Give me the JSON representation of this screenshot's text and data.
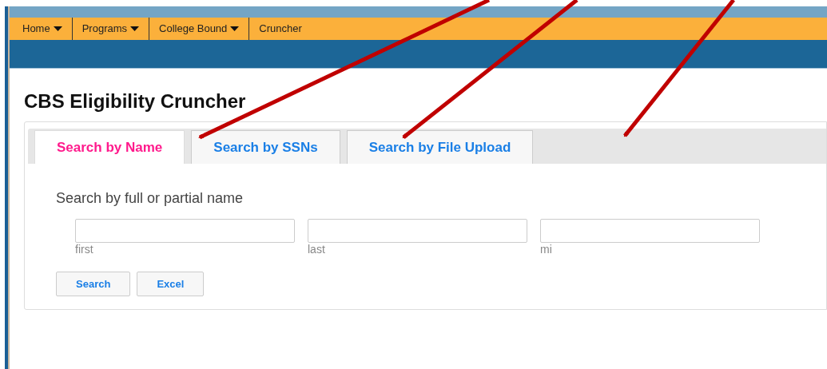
{
  "nav": {
    "items": [
      {
        "label": "Home",
        "dropdown": true
      },
      {
        "label": "Programs",
        "dropdown": true
      },
      {
        "label": "College Bound",
        "dropdown": true
      },
      {
        "label": "Cruncher",
        "dropdown": false
      }
    ]
  },
  "page_title": "CBS Eligibility Cruncher",
  "tabs": [
    {
      "label": "Search by Name",
      "selected": true
    },
    {
      "label": "Search by SSNs",
      "selected": false
    },
    {
      "label": "Search by File Upload",
      "selected": false
    }
  ],
  "search_form": {
    "instruction": "Search by full or partial name",
    "fields": [
      {
        "caption": "first"
      },
      {
        "caption": "last"
      },
      {
        "caption": "mi"
      }
    ],
    "buttons": [
      "Search",
      "Excel"
    ]
  }
}
